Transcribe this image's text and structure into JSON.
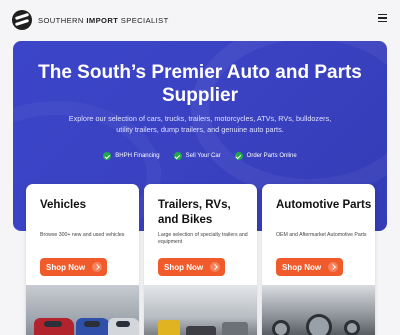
{
  "header": {
    "brand_prefix": "SOUTHERN ",
    "brand_bold": "IMPORT",
    "brand_suffix": " SPECIALIST",
    "logo_icon": "logo-mark-icon",
    "menu_icon": "hamburger-menu-icon"
  },
  "hero": {
    "title": "The South’s Premier Auto and Parts Supplier",
    "subtitle": "Explore our selection of cars, trucks, trailers, motorcycles, ATVs, RVs, bulldozers, utility trailers, dump trailers, and genuine auto parts.",
    "features": [
      {
        "label": "BHPH Financing",
        "icon": "check-circle-icon"
      },
      {
        "label": "Sell Your Car",
        "icon": "check-circle-icon"
      },
      {
        "label": "Order Parts Online",
        "icon": "check-circle-icon"
      }
    ]
  },
  "cards": [
    {
      "title": "Vehicles",
      "description": "Browse 300+ new and used vehicles",
      "button": "Shop Now"
    },
    {
      "title": "Trailers, RVs, and Bikes",
      "description": "Large selection of specialty trailers and equipment",
      "button": "Shop Now"
    },
    {
      "title": "Automotive Parts",
      "description": "OEM and Aftermarket Automotive Parts",
      "button": "Shop Now"
    }
  ],
  "colors": {
    "hero_background": "#3b45c8",
    "button_accent": "#f15b2b",
    "check_green": "#22a84a"
  }
}
